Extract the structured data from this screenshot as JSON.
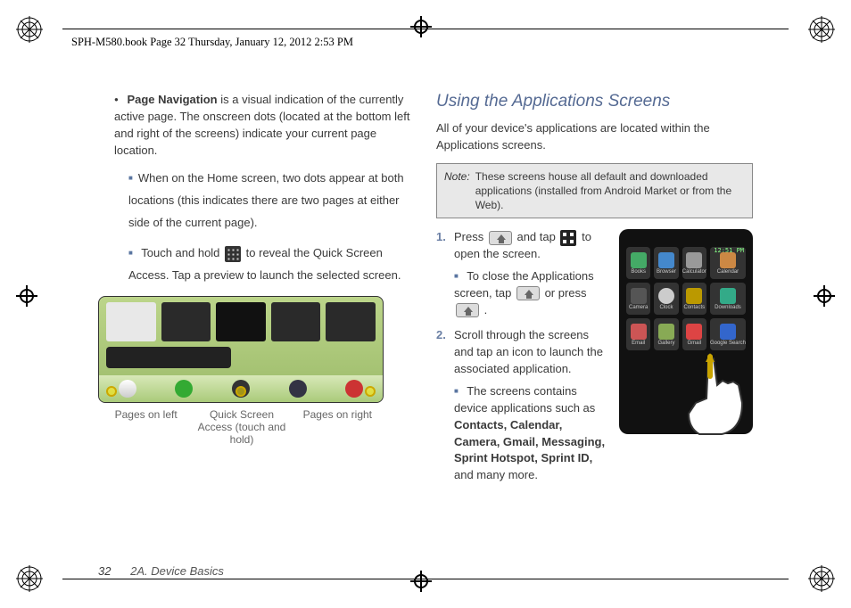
{
  "running_head": "SPH-M580.book  Page 32  Thursday, January 12, 2012  2:53 PM",
  "left": {
    "bullet_label": "Page Navigation",
    "bullet_text": " is a visual indication of the currently active page. The onscreen dots (located at the bottom left and right of the screens) indicate your current page location.",
    "sub1": "When on the Home screen, two dots appear at both locations (this indicates there are two pages at either side of the current page).",
    "sub2a": "Touch and hold ",
    "sub2b": " to reveal the Quick Screen Access. Tap a preview to launch the selected screen.",
    "cap_left": "Pages on left",
    "cap_mid": "Quick Screen Access (touch and hold)",
    "cap_right": "Pages on right"
  },
  "right": {
    "heading": "Using the Applications Screens",
    "intro": "All of your device's applications are located within the Applications screens.",
    "note_label": "Note:",
    "note_text": "These screens house all default and downloaded applications (installed from Android Market or from the Web).",
    "step1a": "Press ",
    "step1b": " and tap ",
    "step1c": " to open the screen.",
    "step1_sub_a": "To close the Applications screen, tap ",
    "step1_sub_b": " or press ",
    "step1_sub_c": ".",
    "step2": "Scroll through the screens and tap an icon to launch the associated application.",
    "step2_sub_a": "The screens contains device applications such as ",
    "step2_sub_b": " and many more.",
    "apps_bold": "Contacts, Calendar, Camera, Gmail, Messaging, Sprint Hotspot, Sprint ID,"
  },
  "phone": {
    "status": "12:51 PM",
    "apps": [
      "Books",
      "Browser",
      "Calculator",
      "Calendar",
      "Camera",
      "Clock",
      "Contacts",
      "Downloads",
      "Email",
      "Gallery",
      "Gmail",
      "Google Search"
    ]
  },
  "footer": {
    "page": "32",
    "section": "2A. Device Basics"
  }
}
